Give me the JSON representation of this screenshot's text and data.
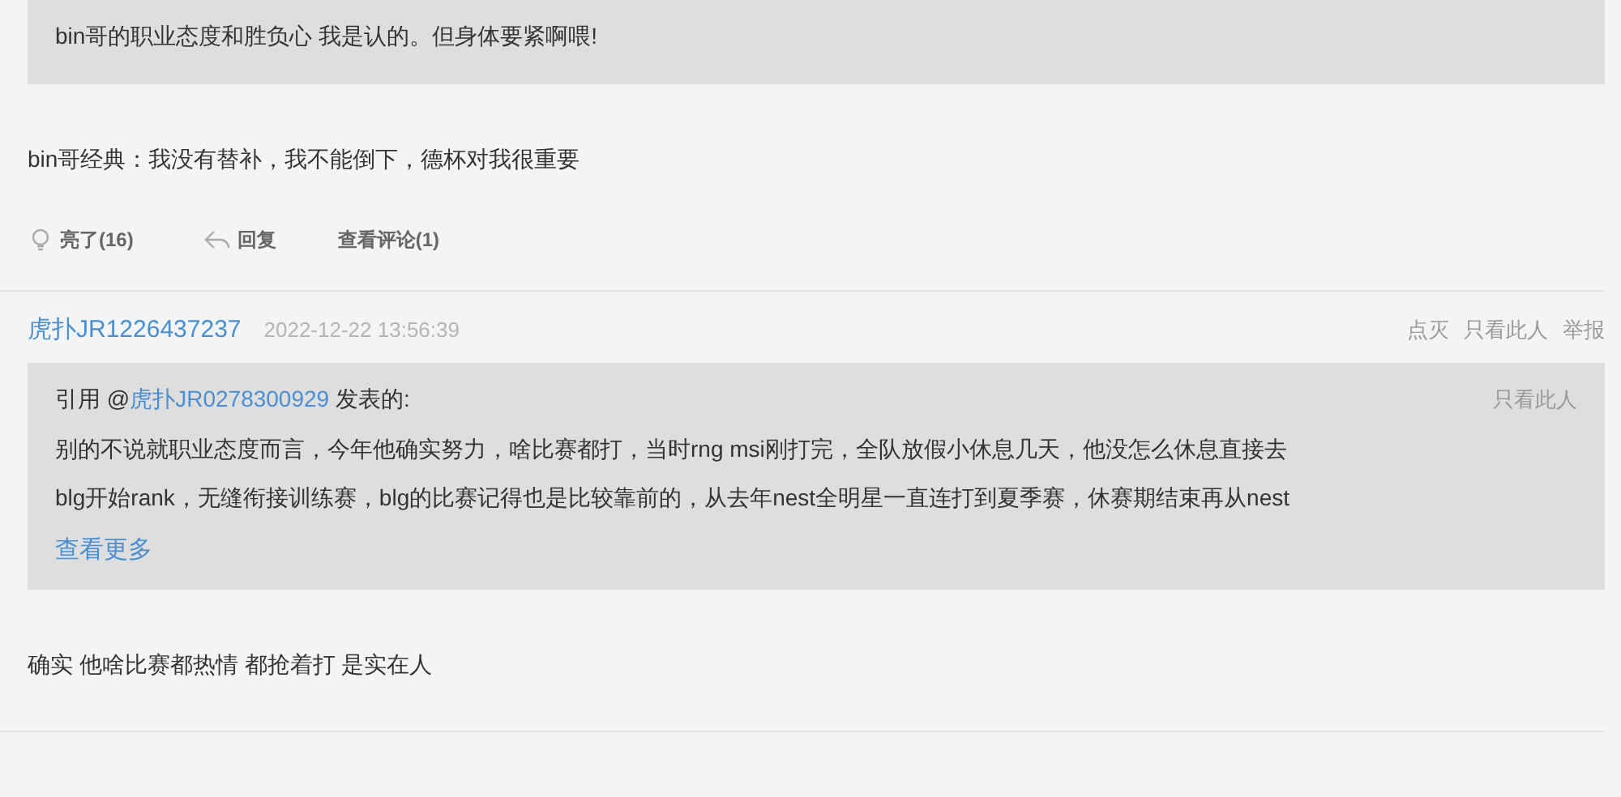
{
  "posts": [
    {
      "kind": "tail",
      "quote": {
        "lines": [
          "bin哥的职业态度和胜负心 我是认的。但身体要紧啊喂!"
        ]
      },
      "body": "bin哥经典：我没有替补，我不能倒下，德杯对我很重要",
      "actions": {
        "like": "亮了(16)",
        "reply": "回复",
        "view": "查看评论(1)"
      }
    },
    {
      "kind": "full",
      "author": "虎扑JR1226437237",
      "time": "2022-12-22 13:56:39",
      "links": [
        "点灭",
        "只看此人",
        "举报"
      ],
      "quote": {
        "prefix": "引用 @",
        "user": "虎扑JR0278300929",
        "suffix": " 发表的:",
        "only": "只看此人",
        "lines": [
          "别的不说就职业态度而言，今年他确实努力，啥比赛都打，当时rng msi刚打完，全队放假小休息几天，他没怎么休息直接去",
          "blg开始rank，无缝衔接训练赛，blg的比赛记得也是比较靠前的，从去年nest全明星一直连打到夏季赛，休赛期结束再从nest"
        ],
        "more": "查看更多"
      },
      "body": "确实 他啥比赛都热情 都抢着打 是实在人"
    }
  ]
}
